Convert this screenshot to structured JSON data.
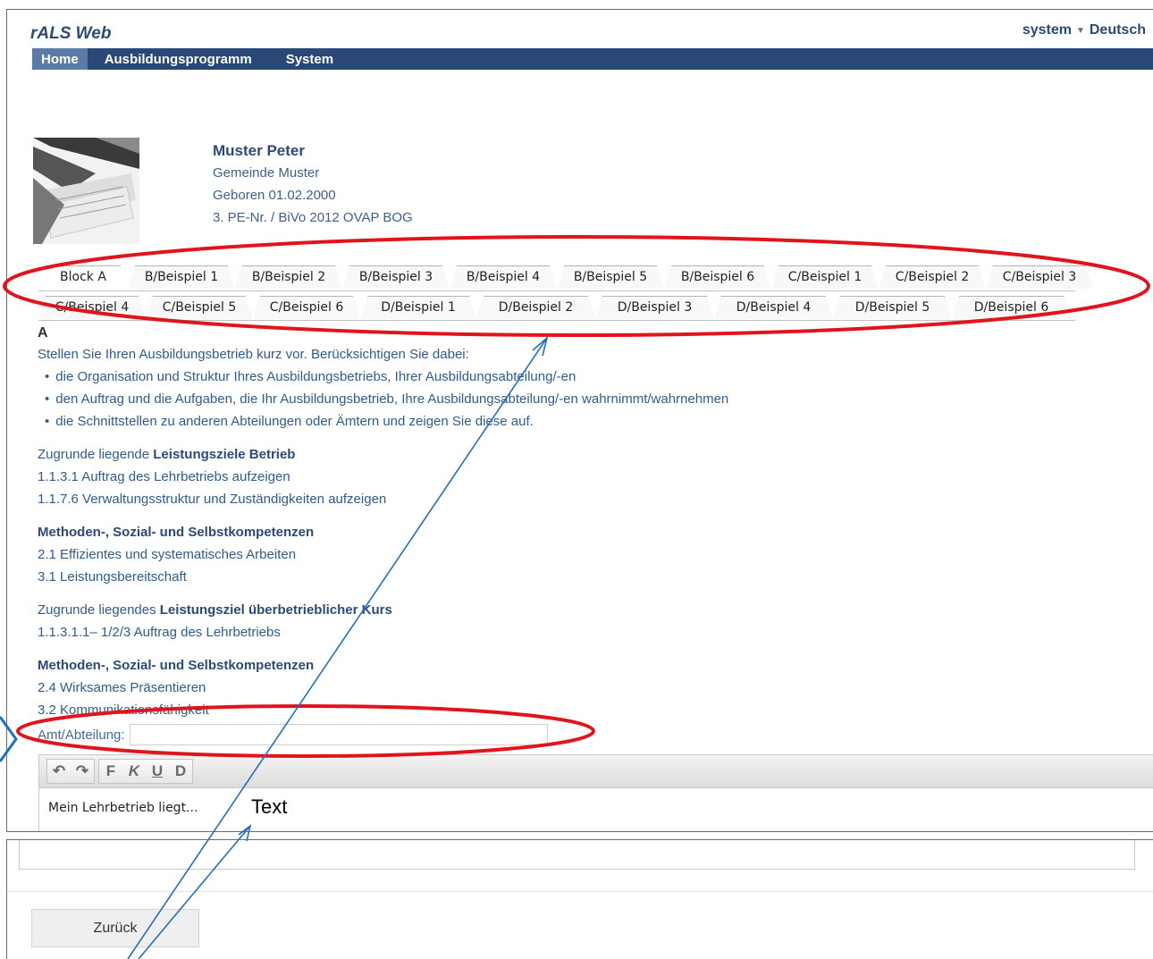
{
  "header": {
    "app_title": "rALS Web",
    "user": "system",
    "language": "Deutsch"
  },
  "nav": {
    "items": [
      {
        "label": "Home",
        "active": true
      },
      {
        "label": "Ausbildungsprogramm",
        "active": false
      },
      {
        "label": "System",
        "active": false
      }
    ]
  },
  "profile": {
    "name": "Muster Peter",
    "municipality": "Gemeinde Muster",
    "birth": "Geboren 01.02.2000",
    "program": "3. PE-Nr. / BiVo 2012 OVAP BOG"
  },
  "tabs": {
    "row1": [
      "Block A",
      "B/Beispiel 1",
      "B/Beispiel 2",
      "B/Beispiel 3",
      "B/Beispiel 4",
      "B/Beispiel 5",
      "B/Beispiel 6",
      "C/Beispiel 1",
      "C/Beispiel 2",
      "C/Beispiel 3"
    ],
    "row2": [
      "C/Beispiel 4",
      "C/Beispiel 5",
      "C/Beispiel 6",
      "D/Beispiel 1",
      "D/Beispiel 2",
      "D/Beispiel 3",
      "D/Beispiel 4",
      "D/Beispiel 5",
      "D/Beispiel 6"
    ],
    "selected": "Block A"
  },
  "content": {
    "section_letter": "A",
    "intro": "Stellen Sie Ihren Ausbildungsbetrieb kurz vor. Berücksichtigen Sie dabei:",
    "bullets": [
      "die Organisation und Struktur Ihres Ausbildungsbetriebs, Ihrer Ausbildungsabteilung/-en",
      "den Auftrag und die Aufgaben, die Ihr Ausbildungsbetrieb, Ihre Ausbildungsabteilung/-en wahrnimmt/wahrnehmen",
      "die Schnittstellen zu anderen Abteilungen oder Ämtern und zeigen Sie diese auf."
    ],
    "goals_betrieb_prefix": "Zugrunde liegende ",
    "goals_betrieb_bold": "Leistungsziele Betrieb",
    "goals_betrieb": [
      "1.1.3.1 Auftrag des Lehrbetriebs aufzeigen",
      "1.1.7.6 Verwaltungsstruktur und Zuständigkeiten aufzeigen"
    ],
    "mss_heading_1": "Methoden-, Sozial- und Selbstkompetenzen",
    "mss_1": [
      "2.1 Effizientes und systematisches Arbeiten",
      "3.1 Leistungsbereitschaft"
    ],
    "goals_kurs_prefix": "Zugrunde liegendes ",
    "goals_kurs_bold": "Leistungsziel überbetrieblicher Kurs",
    "goals_kurs": [
      "1.1.3.1.1– 1/2/3 Auftrag des Lehrbetriebs"
    ],
    "mss_heading_2": "Methoden-, Sozial- und Selbstkompetenzen",
    "mss_2": [
      "2.4 Wirksames Präsentieren",
      "3.2 Kommunikationsfähigkeit"
    ]
  },
  "form": {
    "department_label": "Amt/Abteilung:",
    "department_value": "",
    "editor_text": "Mein Lehrbetrieb liegt..."
  },
  "toolbar": {
    "undo": "↶",
    "redo": "↷",
    "bold": "F",
    "italic": "K",
    "underline": "U",
    "strike": "D"
  },
  "annotation": {
    "text_label": "Text",
    "ellipse_color": "#e0141c",
    "arrow_color": "#1f6fc4"
  },
  "footer": {
    "back_label": "Zurück"
  }
}
